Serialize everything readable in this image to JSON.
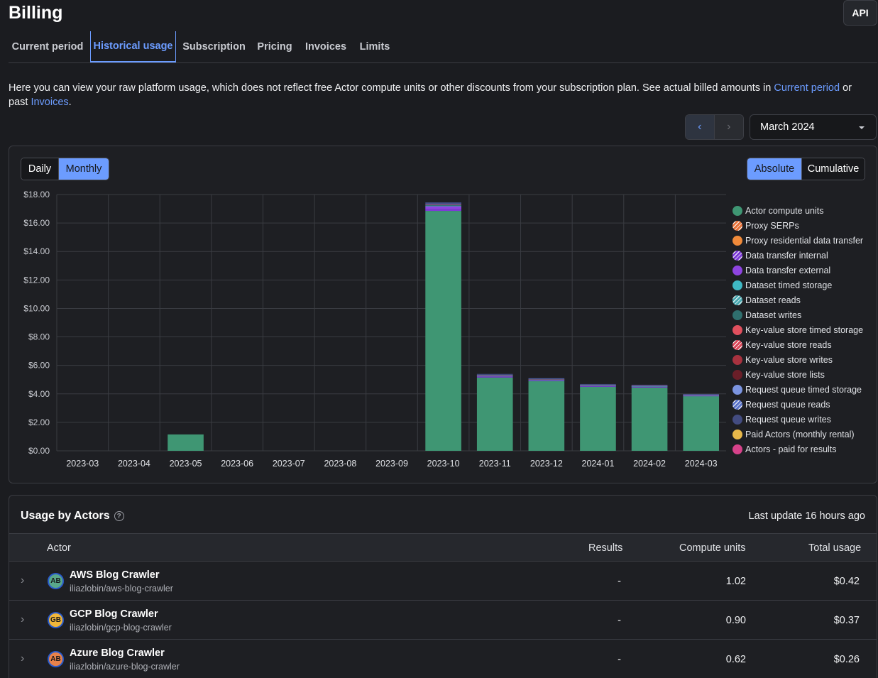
{
  "page": {
    "title": "Billing",
    "api_button": "API"
  },
  "tabs": [
    {
      "label": "Current period",
      "active": false
    },
    {
      "label": "Historical usage",
      "active": true
    },
    {
      "label": "Subscription",
      "active": false
    },
    {
      "label": "Pricing",
      "active": false
    },
    {
      "label": "Invoices",
      "active": false
    },
    {
      "label": "Limits",
      "active": false
    }
  ],
  "intro": {
    "text_before": "Here you can view your raw platform usage, which does not reflect free Actor compute units or other discounts from your subscription plan. See actual billed amounts in ",
    "link_current": "Current period",
    "text_mid": " or past ",
    "link_invoices": "Invoices",
    "text_end": "."
  },
  "period_nav": {
    "prev_icon": "chevron-left-icon",
    "next_icon": "chevron-right-icon",
    "selected_month": "March 2024"
  },
  "granularity": {
    "options": [
      "Daily",
      "Monthly"
    ],
    "selected": "Monthly"
  },
  "mode": {
    "options": [
      "Absolute",
      "Cumulative"
    ],
    "selected": "Absolute"
  },
  "chart_data": {
    "type": "bar",
    "stacked": true,
    "categories": [
      "2023-03",
      "2023-04",
      "2023-05",
      "2023-06",
      "2023-07",
      "2023-08",
      "2023-09",
      "2023-10",
      "2023-11",
      "2023-12",
      "2024-01",
      "2024-02",
      "2024-03"
    ],
    "ylim": [
      0,
      18
    ],
    "y_ticks": [
      "$0.00",
      "$2.00",
      "$4.00",
      "$6.00",
      "$8.00",
      "$10.00",
      "$12.00",
      "$14.00",
      "$16.00",
      "$18.00"
    ],
    "grid": true,
    "legend_position": "right",
    "series": [
      {
        "name": "Actor compute units",
        "color": "#3f9673",
        "values": [
          0,
          0,
          1.15,
          0,
          0,
          0,
          0,
          16.85,
          5.15,
          4.9,
          4.5,
          4.45,
          3.85
        ]
      },
      {
        "name": "Proxy SERPs",
        "color": "#e8733a",
        "values": [
          0,
          0,
          0,
          0,
          0,
          0,
          0,
          0,
          0,
          0,
          0,
          0,
          0
        ]
      },
      {
        "name": "Proxy residential data transfer",
        "color": "#f08a3a",
        "values": [
          0,
          0,
          0,
          0,
          0,
          0,
          0,
          0,
          0,
          0,
          0,
          0,
          0
        ]
      },
      {
        "name": "Data transfer internal",
        "color": "#7d3bd6",
        "values": [
          0,
          0,
          0,
          0,
          0,
          0,
          0,
          0.12,
          0.05,
          0.04,
          0.03,
          0.03,
          0.02
        ]
      },
      {
        "name": "Data transfer external",
        "color": "#8e44e0",
        "values": [
          0,
          0,
          0,
          0,
          0,
          0,
          0,
          0.2,
          0.05,
          0.04,
          0.04,
          0.04,
          0.03
        ]
      },
      {
        "name": "Dataset timed storage",
        "color": "#3fb8c4",
        "values": [
          0,
          0,
          0,
          0,
          0,
          0,
          0,
          0,
          0,
          0,
          0,
          0,
          0
        ]
      },
      {
        "name": "Dataset reads",
        "color": "#4aa8b0",
        "values": [
          0,
          0,
          0,
          0,
          0,
          0,
          0,
          0.05,
          0.02,
          0.02,
          0.02,
          0.02,
          0.01
        ]
      },
      {
        "name": "Dataset writes",
        "color": "#2f6f6e",
        "values": [
          0,
          0,
          0,
          0,
          0,
          0,
          0,
          0.05,
          0.02,
          0.02,
          0.02,
          0.02,
          0.02
        ]
      },
      {
        "name": "Key-value store timed storage",
        "color": "#e0505e",
        "values": [
          0,
          0,
          0,
          0,
          0,
          0,
          0,
          0,
          0,
          0,
          0,
          0,
          0
        ]
      },
      {
        "name": "Key-value store reads",
        "color": "#d9485a",
        "values": [
          0,
          0,
          0,
          0,
          0,
          0,
          0,
          0,
          0,
          0,
          0,
          0,
          0
        ]
      },
      {
        "name": "Key-value store writes",
        "color": "#a8323f",
        "values": [
          0,
          0,
          0,
          0,
          0,
          0,
          0,
          0.03,
          0.02,
          0.02,
          0.02,
          0.02,
          0.01
        ]
      },
      {
        "name": "Key-value store lists",
        "color": "#6a1e28",
        "values": [
          0,
          0,
          0,
          0,
          0,
          0,
          0,
          0,
          0,
          0,
          0,
          0,
          0
        ]
      },
      {
        "name": "Request queue timed storage",
        "color": "#7b94e0",
        "values": [
          0,
          0,
          0,
          0,
          0,
          0,
          0,
          0,
          0,
          0,
          0,
          0,
          0
        ]
      },
      {
        "name": "Request queue reads",
        "color": "#5a73c8",
        "values": [
          0,
          0,
          0,
          0,
          0,
          0,
          0,
          0.05,
          0.03,
          0.02,
          0.02,
          0.02,
          0.02
        ]
      },
      {
        "name": "Request queue writes",
        "color": "#434c80",
        "values": [
          0,
          0,
          0,
          0,
          0,
          0,
          0,
          0.1,
          0.06,
          0.04,
          0.04,
          0.04,
          0.03
        ]
      },
      {
        "name": "Paid Actors (monthly rental)",
        "color": "#e8b84a",
        "values": [
          0,
          0,
          0,
          0,
          0,
          0,
          0,
          0,
          0,
          0,
          0,
          0,
          0
        ]
      },
      {
        "name": "Actors - paid for results",
        "color": "#d6428a",
        "values": [
          0,
          0,
          0,
          0,
          0,
          0,
          0,
          0,
          0,
          0,
          0,
          0,
          0
        ]
      }
    ]
  },
  "usage_by_actors": {
    "title": "Usage by Actors",
    "last_update": "Last update 16 hours ago",
    "columns": {
      "actor": "Actor",
      "results": "Results",
      "compute_units": "Compute units",
      "total_usage": "Total usage"
    },
    "rows": [
      {
        "initials": "AB",
        "avatar_color": "#5aa88a",
        "name": "AWS Blog Crawler",
        "slug": "iliazlobin/aws-blog-crawler",
        "results": "-",
        "compute_units": "1.02",
        "total_usage": "$0.42"
      },
      {
        "initials": "GB",
        "avatar_color": "#f0b63a",
        "name": "GCP Blog Crawler",
        "slug": "iliazlobin/gcp-blog-crawler",
        "results": "-",
        "compute_units": "0.90",
        "total_usage": "$0.37"
      },
      {
        "initials": "AB",
        "avatar_color": "#e8824a",
        "name": "Azure Blog Crawler",
        "slug": "iliazlobin/azure-blog-crawler",
        "results": "-",
        "compute_units": "0.62",
        "total_usage": "$0.26"
      }
    ]
  }
}
